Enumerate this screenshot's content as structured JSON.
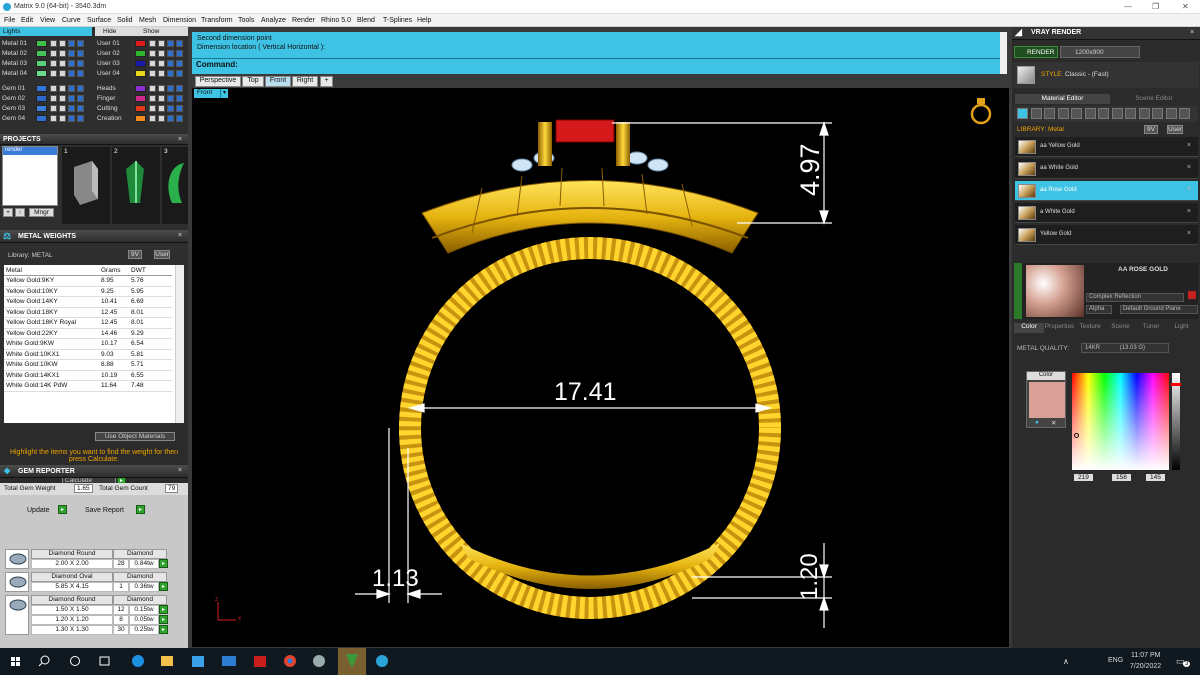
{
  "window": {
    "title": "Matrix 9.0 (64-bit) - 3540.3dm",
    "min": "—",
    "max": "❐",
    "close": "✕"
  },
  "menu": [
    "File",
    "Edit",
    "View",
    "Curve",
    "Surface",
    "Solid",
    "Mesh",
    "Dimension",
    "Transform",
    "Tools",
    "Analyze",
    "Render",
    "Rhino 5.0",
    "Blend",
    "T-Splines",
    "Help"
  ],
  "layers": {
    "header": "Lights",
    "hide": "Hide",
    "show": "Show",
    "left": [
      {
        "label": "Metal 01",
        "color": "#3dbf4a"
      },
      {
        "label": "Metal 02",
        "color": "#46c35a"
      },
      {
        "label": "Metal 03",
        "color": "#5bd07a"
      },
      {
        "label": "Metal 04",
        "color": "#6bdc8e"
      },
      {
        "label": "Gem 01",
        "color": "#3275d8"
      },
      {
        "label": "Gem 02",
        "color": "#2c66c8"
      },
      {
        "label": "Gem 03",
        "color": "#3a80de"
      },
      {
        "label": "Gem 04",
        "color": "#2f70d2"
      }
    ],
    "right": [
      {
        "label": "User 01",
        "color": "#e01b1b"
      },
      {
        "label": "User 02",
        "color": "#2fb52f"
      },
      {
        "label": "User 03",
        "color": "#1a1aa8"
      },
      {
        "label": "User 04",
        "color": "#e8d81c"
      },
      {
        "label": "Heads",
        "color": "#8a2fd0"
      },
      {
        "label": "Finger",
        "color": "#d02a8e"
      },
      {
        "label": "Cutting",
        "color": "#e23b1b"
      },
      {
        "label": "Creation",
        "color": "#f08a1c"
      }
    ]
  },
  "projects": {
    "title": "PROJECTS",
    "item": "render",
    "thumbs": [
      "1",
      "2",
      "3"
    ],
    "manage": "Mngr"
  },
  "metal_weights": {
    "title": "METAL WEIGHTS",
    "library": "Library: METAL",
    "lib_btn1": "9V",
    "lib_btn2": "User",
    "columns": [
      "Metal",
      "Grams",
      "DWT"
    ],
    "rows": [
      [
        "Yellow Gold:9KY",
        "8.95",
        "5.76"
      ],
      [
        "Yellow Gold:10KY",
        "9.25",
        "5.95"
      ],
      [
        "Yellow Gold:14KY",
        "10.41",
        "6.69"
      ],
      [
        "Yellow Gold:18KY",
        "12.45",
        "8.01"
      ],
      [
        "Yellow Gold:18KY Royal",
        "12.45",
        "8.01"
      ],
      [
        "Yellow Gold:22KY",
        "14.46",
        "9.29"
      ],
      [
        "White Gold:9KW",
        "10.17",
        "6.54"
      ],
      [
        "White Gold:10KX1",
        "9.03",
        "5.81"
      ],
      [
        "White Gold:10KW",
        "8.88",
        "5.71"
      ],
      [
        "White Gold:14KX1",
        "10.19",
        "6.55"
      ],
      [
        "White Gold:14K PdW",
        "11.64",
        "7.48"
      ]
    ],
    "use_object": "Use Object Materials",
    "hint": "Highlight the items you want to find the weight for then press Calculate.",
    "calculate": "Calculate"
  },
  "gem_reporter": {
    "title": "GEM REPORTER",
    "total_weight_label": "Total Gem Weight",
    "total_weight": "1.65",
    "total_count_label": "Total Gem Count",
    "total_count": "79",
    "update": "Update",
    "save_report": "Save Report",
    "groups": [
      {
        "shape": "Diamond Round",
        "type": "Diamond",
        "rows": [
          [
            "2.00 X 2.00",
            "28",
            "0.84tw"
          ]
        ]
      },
      {
        "shape": "Diamond Oval",
        "type": "Diamond",
        "rows": [
          [
            "5.85 X 4.15",
            "1",
            "0.36tw"
          ]
        ]
      },
      {
        "shape": "Diamond Round",
        "type": "Diamond",
        "rows": [
          [
            "1.50 X 1.50",
            "12",
            "0.15tw"
          ],
          [
            "1.20 X 1.20",
            "8",
            "0.05tw"
          ],
          [
            "1.30 X 1.30",
            "30",
            "0.25tw"
          ]
        ]
      }
    ]
  },
  "command": {
    "line1": "Second dimension point",
    "line2": "Dimension location ( Vertical  Horizontal ):",
    "prompt": "Command:"
  },
  "view_tabs": [
    "Perspective",
    "Top",
    "Front",
    "Right"
  ],
  "view_add": "+",
  "active_view": "Front",
  "dimensions": {
    "top_height": "4.97",
    "width": "17.41",
    "side_gap": "1.13",
    "bottom_height": "1.20"
  },
  "axis": {
    "z": "z",
    "x": "x"
  },
  "vray": {
    "title": "VRAY RENDER",
    "render": "RENDER",
    "resolution": "1200x900",
    "style_label": "STYLE",
    "style_value": "Classic - (Fast)",
    "tabs": [
      "Material Editor",
      "Scene Editor"
    ],
    "library": "LIBRARY: Metal",
    "lib_btn1": "9V",
    "lib_btn2": "User",
    "materials": [
      "aa Yellow Gold",
      "aa White Gold",
      "aa Rose Gold",
      "a White Gold",
      "Yellow Gold"
    ],
    "material_name": "AA ROSE GOLD",
    "reflection": "Complex Reflection",
    "alpha": "Alpha",
    "ground": "Default Ground Plane",
    "sub_tabs": [
      "Color",
      "Properties",
      "Texture",
      "Scene",
      "Tuner",
      "Light"
    ],
    "metal_quality_label": "METAL QUALITY:",
    "metal_quality": "14KR",
    "metal_quality_value": "(13.03 G)",
    "color_label": "Color",
    "swatch_color": "#d8a097",
    "rgb": [
      "219",
      "158",
      "145"
    ]
  },
  "taskbar": {
    "time": "11:07 PM",
    "date": "7/20/2022",
    "lang": "ENG",
    "notif": "3"
  }
}
